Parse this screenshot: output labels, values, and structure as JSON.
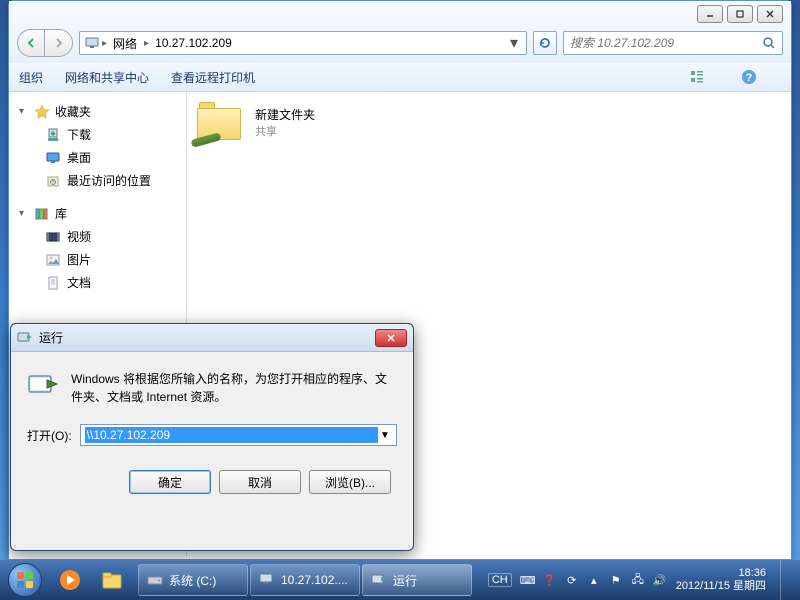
{
  "explorer": {
    "breadcrumb": {
      "network": "网络",
      "host": "10.27.102.209"
    },
    "search_placeholder": "搜索 10.27.102.209",
    "toolbar": {
      "organize": "组织",
      "center": "网络和共享中心",
      "printers": "查看远程打印机"
    },
    "sidebar": {
      "favorites": {
        "header": "收藏夹",
        "downloads": "下载",
        "desktop": "桌面",
        "recent": "最近访问的位置"
      },
      "libraries": {
        "header": "库",
        "videos": "视频",
        "pictures": "图片",
        "documents": "文档"
      }
    },
    "content": {
      "folder_name": "新建文件夹",
      "folder_sub": "共享"
    }
  },
  "run_dialog": {
    "title": "运行",
    "message": "Windows 将根据您所输入的名称，为您打开相应的程序、文件夹、文档或 Internet 资源。",
    "open_label": "打开(O):",
    "input_value": "\\\\10.27.102.209",
    "ok": "确定",
    "cancel": "取消",
    "browse": "浏览(B)..."
  },
  "taskbar": {
    "task1": "系统 (C:)",
    "task2": "10.27.102....",
    "task3": "运行",
    "ime": "CH",
    "time": "18:36",
    "date": "2012/11/15 星期四"
  }
}
